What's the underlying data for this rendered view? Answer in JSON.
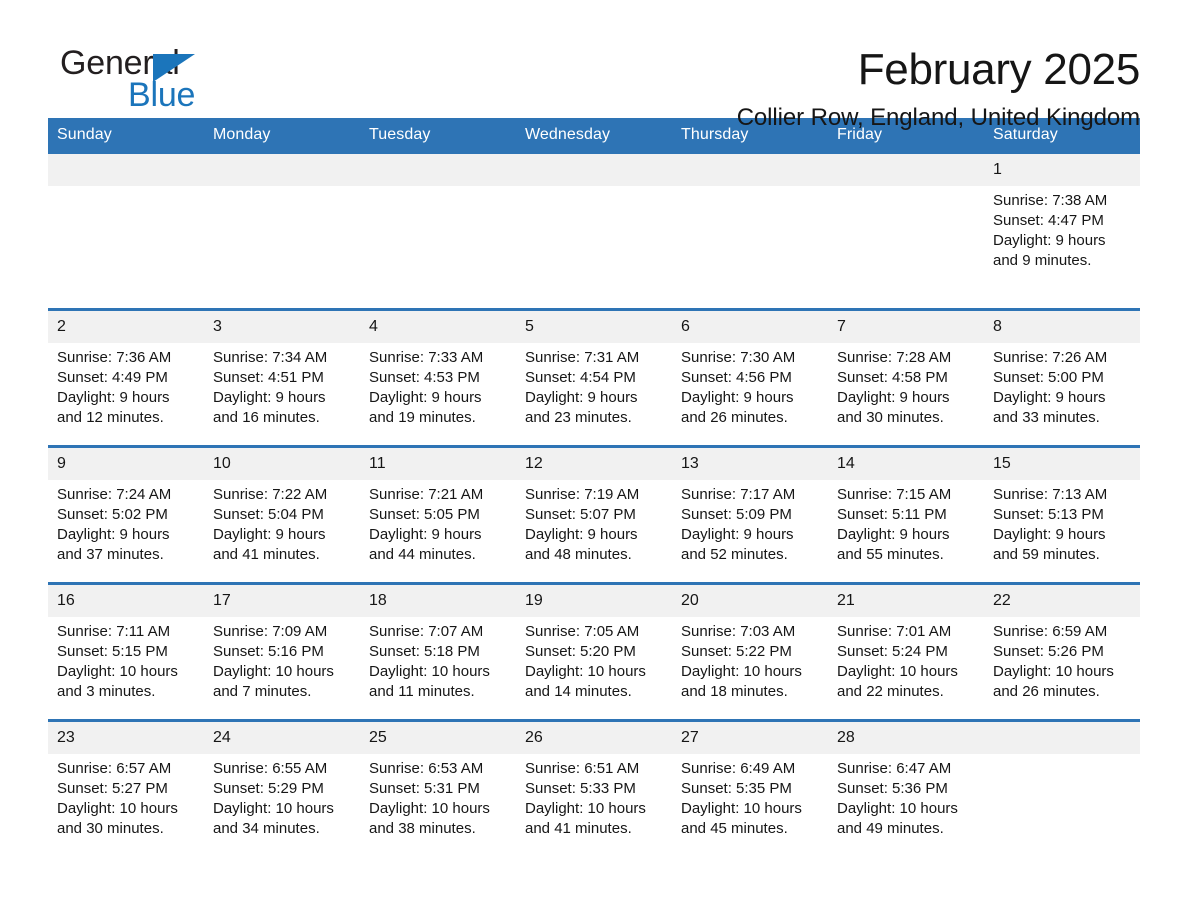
{
  "brand": {
    "name_dark": "General",
    "name_light": "Blue",
    "accent_color": "#1b75bb"
  },
  "header": {
    "month_title": "February 2025",
    "location": "Collier Row, England, United Kingdom",
    "header_bg_color": "#2e74b5",
    "daynum_bg_color": "#f1f1f1"
  },
  "weekdays": [
    "Sunday",
    "Monday",
    "Tuesday",
    "Wednesday",
    "Thursday",
    "Friday",
    "Saturday"
  ],
  "weeks": [
    [
      {
        "day": "",
        "sunrise": "",
        "sunset": "",
        "daylight1": "",
        "daylight2": ""
      },
      {
        "day": "",
        "sunrise": "",
        "sunset": "",
        "daylight1": "",
        "daylight2": ""
      },
      {
        "day": "",
        "sunrise": "",
        "sunset": "",
        "daylight1": "",
        "daylight2": ""
      },
      {
        "day": "",
        "sunrise": "",
        "sunset": "",
        "daylight1": "",
        "daylight2": ""
      },
      {
        "day": "",
        "sunrise": "",
        "sunset": "",
        "daylight1": "",
        "daylight2": ""
      },
      {
        "day": "",
        "sunrise": "",
        "sunset": "",
        "daylight1": "",
        "daylight2": ""
      },
      {
        "day": "1",
        "sunrise": "Sunrise: 7:38 AM",
        "sunset": "Sunset: 4:47 PM",
        "daylight1": "Daylight: 9 hours",
        "daylight2": "and 9 minutes."
      }
    ],
    [
      {
        "day": "2",
        "sunrise": "Sunrise: 7:36 AM",
        "sunset": "Sunset: 4:49 PM",
        "daylight1": "Daylight: 9 hours",
        "daylight2": "and 12 minutes."
      },
      {
        "day": "3",
        "sunrise": "Sunrise: 7:34 AM",
        "sunset": "Sunset: 4:51 PM",
        "daylight1": "Daylight: 9 hours",
        "daylight2": "and 16 minutes."
      },
      {
        "day": "4",
        "sunrise": "Sunrise: 7:33 AM",
        "sunset": "Sunset: 4:53 PM",
        "daylight1": "Daylight: 9 hours",
        "daylight2": "and 19 minutes."
      },
      {
        "day": "5",
        "sunrise": "Sunrise: 7:31 AM",
        "sunset": "Sunset: 4:54 PM",
        "daylight1": "Daylight: 9 hours",
        "daylight2": "and 23 minutes."
      },
      {
        "day": "6",
        "sunrise": "Sunrise: 7:30 AM",
        "sunset": "Sunset: 4:56 PM",
        "daylight1": "Daylight: 9 hours",
        "daylight2": "and 26 minutes."
      },
      {
        "day": "7",
        "sunrise": "Sunrise: 7:28 AM",
        "sunset": "Sunset: 4:58 PM",
        "daylight1": "Daylight: 9 hours",
        "daylight2": "and 30 minutes."
      },
      {
        "day": "8",
        "sunrise": "Sunrise: 7:26 AM",
        "sunset": "Sunset: 5:00 PM",
        "daylight1": "Daylight: 9 hours",
        "daylight2": "and 33 minutes."
      }
    ],
    [
      {
        "day": "9",
        "sunrise": "Sunrise: 7:24 AM",
        "sunset": "Sunset: 5:02 PM",
        "daylight1": "Daylight: 9 hours",
        "daylight2": "and 37 minutes."
      },
      {
        "day": "10",
        "sunrise": "Sunrise: 7:22 AM",
        "sunset": "Sunset: 5:04 PM",
        "daylight1": "Daylight: 9 hours",
        "daylight2": "and 41 minutes."
      },
      {
        "day": "11",
        "sunrise": "Sunrise: 7:21 AM",
        "sunset": "Sunset: 5:05 PM",
        "daylight1": "Daylight: 9 hours",
        "daylight2": "and 44 minutes."
      },
      {
        "day": "12",
        "sunrise": "Sunrise: 7:19 AM",
        "sunset": "Sunset: 5:07 PM",
        "daylight1": "Daylight: 9 hours",
        "daylight2": "and 48 minutes."
      },
      {
        "day": "13",
        "sunrise": "Sunrise: 7:17 AM",
        "sunset": "Sunset: 5:09 PM",
        "daylight1": "Daylight: 9 hours",
        "daylight2": "and 52 minutes."
      },
      {
        "day": "14",
        "sunrise": "Sunrise: 7:15 AM",
        "sunset": "Sunset: 5:11 PM",
        "daylight1": "Daylight: 9 hours",
        "daylight2": "and 55 minutes."
      },
      {
        "day": "15",
        "sunrise": "Sunrise: 7:13 AM",
        "sunset": "Sunset: 5:13 PM",
        "daylight1": "Daylight: 9 hours",
        "daylight2": "and 59 minutes."
      }
    ],
    [
      {
        "day": "16",
        "sunrise": "Sunrise: 7:11 AM",
        "sunset": "Sunset: 5:15 PM",
        "daylight1": "Daylight: 10 hours",
        "daylight2": "and 3 minutes."
      },
      {
        "day": "17",
        "sunrise": "Sunrise: 7:09 AM",
        "sunset": "Sunset: 5:16 PM",
        "daylight1": "Daylight: 10 hours",
        "daylight2": "and 7 minutes."
      },
      {
        "day": "18",
        "sunrise": "Sunrise: 7:07 AM",
        "sunset": "Sunset: 5:18 PM",
        "daylight1": "Daylight: 10 hours",
        "daylight2": "and 11 minutes."
      },
      {
        "day": "19",
        "sunrise": "Sunrise: 7:05 AM",
        "sunset": "Sunset: 5:20 PM",
        "daylight1": "Daylight: 10 hours",
        "daylight2": "and 14 minutes."
      },
      {
        "day": "20",
        "sunrise": "Sunrise: 7:03 AM",
        "sunset": "Sunset: 5:22 PM",
        "daylight1": "Daylight: 10 hours",
        "daylight2": "and 18 minutes."
      },
      {
        "day": "21",
        "sunrise": "Sunrise: 7:01 AM",
        "sunset": "Sunset: 5:24 PM",
        "daylight1": "Daylight: 10 hours",
        "daylight2": "and 22 minutes."
      },
      {
        "day": "22",
        "sunrise": "Sunrise: 6:59 AM",
        "sunset": "Sunset: 5:26 PM",
        "daylight1": "Daylight: 10 hours",
        "daylight2": "and 26 minutes."
      }
    ],
    [
      {
        "day": "23",
        "sunrise": "Sunrise: 6:57 AM",
        "sunset": "Sunset: 5:27 PM",
        "daylight1": "Daylight: 10 hours",
        "daylight2": "and 30 minutes."
      },
      {
        "day": "24",
        "sunrise": "Sunrise: 6:55 AM",
        "sunset": "Sunset: 5:29 PM",
        "daylight1": "Daylight: 10 hours",
        "daylight2": "and 34 minutes."
      },
      {
        "day": "25",
        "sunrise": "Sunrise: 6:53 AM",
        "sunset": "Sunset: 5:31 PM",
        "daylight1": "Daylight: 10 hours",
        "daylight2": "and 38 minutes."
      },
      {
        "day": "26",
        "sunrise": "Sunrise: 6:51 AM",
        "sunset": "Sunset: 5:33 PM",
        "daylight1": "Daylight: 10 hours",
        "daylight2": "and 41 minutes."
      },
      {
        "day": "27",
        "sunrise": "Sunrise: 6:49 AM",
        "sunset": "Sunset: 5:35 PM",
        "daylight1": "Daylight: 10 hours",
        "daylight2": "and 45 minutes."
      },
      {
        "day": "28",
        "sunrise": "Sunrise: 6:47 AM",
        "sunset": "Sunset: 5:36 PM",
        "daylight1": "Daylight: 10 hours",
        "daylight2": "and 49 minutes."
      },
      {
        "day": "",
        "sunrise": "",
        "sunset": "",
        "daylight1": "",
        "daylight2": ""
      }
    ]
  ]
}
